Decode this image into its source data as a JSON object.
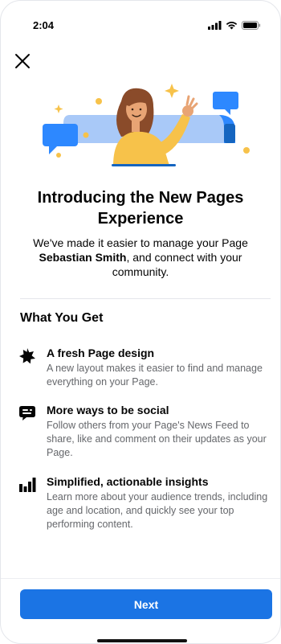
{
  "status_bar": {
    "time": "2:04"
  },
  "close_icon": "close-icon",
  "illustration": {
    "description_icon": "person-waving-illustration",
    "colors": {
      "blue": "#2d88ff",
      "light_blue": "#a9c9f8",
      "yellow": "#f7c24a",
      "hair": "#8a4b2a"
    }
  },
  "headline": "Introducing the New Pages Experience",
  "intro": {
    "before": "We've made it easier to manage your Page ",
    "page_name": "Sebastian Smith",
    "after": ", and connect with your community."
  },
  "section_title": "What You Get",
  "features": [
    {
      "icon": "star-burst-icon",
      "title": "A fresh Page design",
      "description": "A new layout makes it easier to find and manage everything on your Page."
    },
    {
      "icon": "chat-bubble-icon",
      "title": "More ways to be social",
      "description": "Follow others from your Page's News Feed to share, like and comment on their updates as your Page."
    },
    {
      "icon": "bar-chart-icon",
      "title": "Simplified, actionable insights",
      "description": "Learn more about your audience trends, including age and location, and quickly see your top performing content."
    }
  ],
  "next_button": "Next",
  "colors": {
    "accent": "#1b74e4",
    "text": "#050505",
    "secondary_text": "#65676b"
  }
}
